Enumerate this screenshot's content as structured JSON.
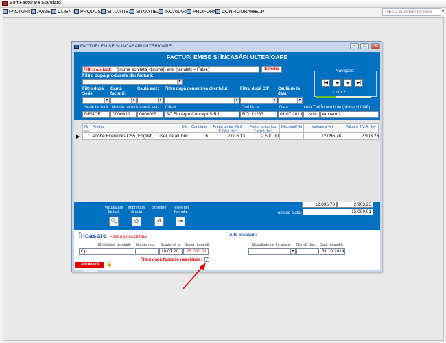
{
  "app": {
    "title": "Soft Facturare Standard"
  },
  "menu": [
    {
      "label": "FACTURI",
      "icon": "invoice-icon"
    },
    {
      "label": "AVIZE",
      "icon": "notice-icon"
    },
    {
      "label": "CLIENTI",
      "icon": "clients-icon"
    },
    {
      "label": "PRODUSE",
      "icon": "products-icon"
    },
    {
      "label": "SITUATIE1",
      "icon": "report-icon"
    },
    {
      "label": "SITUATIE2",
      "icon": "report-icon"
    },
    {
      "label": "INCASARI",
      "icon": "payments-icon"
    },
    {
      "label": "PROFORME",
      "icon": "proforma-icon"
    },
    {
      "label": "CONFIGURARE",
      "icon": "settings-icon"
    },
    {
      "label": "HELP",
      "icon": ""
    }
  ],
  "help_box": {
    "placeholder": "Type a question for help"
  },
  "window": {
    "title": "FACTURI EMISE SI INCASARI ULTERIOARE"
  },
  "form": {
    "title": "FACTURI EMISE ȘI ÎNCASĂRI ULTERIOARE",
    "filter_applied_label": "Filtru aplicat:",
    "filter_applied_value": "([suma achitata]<[suma]) and ([anulat] = False)",
    "remove_filter_label": "Elimina",
    "product_filter_label": "Filtru după produsele din factură:",
    "search_labels": [
      "Filtru după Serie:",
      "Caută factură:",
      "Caută aviz:",
      "Filtru după denumirea clientului:",
      "Filtru după CIF:",
      "Caută de la data:"
    ],
    "navigation": {
      "label": "Navigare:",
      "buttons": [
        "first",
        "previous",
        "next",
        "last"
      ],
      "record_text": "1  din  2",
      "progress": 0.35
    }
  },
  "invoice_header": {
    "labels": [
      "Serie factură",
      "Număr factură",
      "Număr aviz:",
      "Client",
      "Cod fiscal",
      "Data",
      "cota TVA:",
      "Întocmit de (Nume si CNP):"
    ],
    "values": {
      "serie": "DEMOF",
      "numar_factura": "0000020",
      "numar_aviz": "0000015",
      "client": "SC Bio Agro Concept S.R.L.",
      "cod_fiscal": "RO112233",
      "data": "01.07.2013",
      "cota_tva": "24%",
      "intocmit": "emitent 2"
    }
  },
  "grid": {
    "columns": [
      "Nr. crt.",
      "Produs",
      "UM",
      "Cantitate",
      "Prețul unitar (fără T.V.A.) -lei-",
      "Prețul unitar (cu T.V.A.) -lei-",
      "Discount(%)",
      "Valoarea -lei-",
      "Valoare T.V.A. -lei-"
    ],
    "rows": [
      {
        "nr": "1",
        "produs": "Adobe Fireworks CS5, English, 1 user, retail",
        "um": "buc",
        "cantitate": "6",
        "pret_fara_tva": "2.016,13",
        "pret_cu_tva": "2.500,00",
        "discount": "",
        "valoare": "12.096,78",
        "valoare_tva": "2.903,23"
      }
    ]
  },
  "actions": [
    {
      "label": "Vizualizare factură",
      "icon": "preview-icon"
    },
    {
      "label": "Imprimare directă",
      "icon": "printer-icon"
    },
    {
      "label": "Stornare",
      "icon": "storno-icon"
    },
    {
      "label": "Ieșire din formular",
      "icon": "exit-icon"
    }
  ],
  "totals": {
    "valoare": "12.096,78",
    "tva": "2.903,23",
    "total_label": "Total de plată",
    "total": "15.000,01"
  },
  "incasare": {
    "title": "Încasare:",
    "status": "Factura neachitată",
    "labels": [
      "Modalitate de plată:",
      "Număr doc.:",
      "Scadență la:",
      "Suma restantă:"
    ],
    "modalitate": "Op",
    "numar_doc": "",
    "scadenta": "10.07.2013",
    "suma_restanta": "15.000,01",
    "filter_unpaid_label": "Filtru după facturile neachitate:",
    "cancel_label": "Anulează factura"
  },
  "alte_incasari": {
    "title": "Alte încasări:",
    "labels": [
      "Modalitate de încasare:",
      "Număr doc.:",
      "Dată încasării:"
    ],
    "data_incasarii": "31.10.2014"
  },
  "colors": {
    "panel_blue": "#0070c0",
    "accent_red": "#e00000",
    "header_text_blue": "#1e5aa5"
  }
}
